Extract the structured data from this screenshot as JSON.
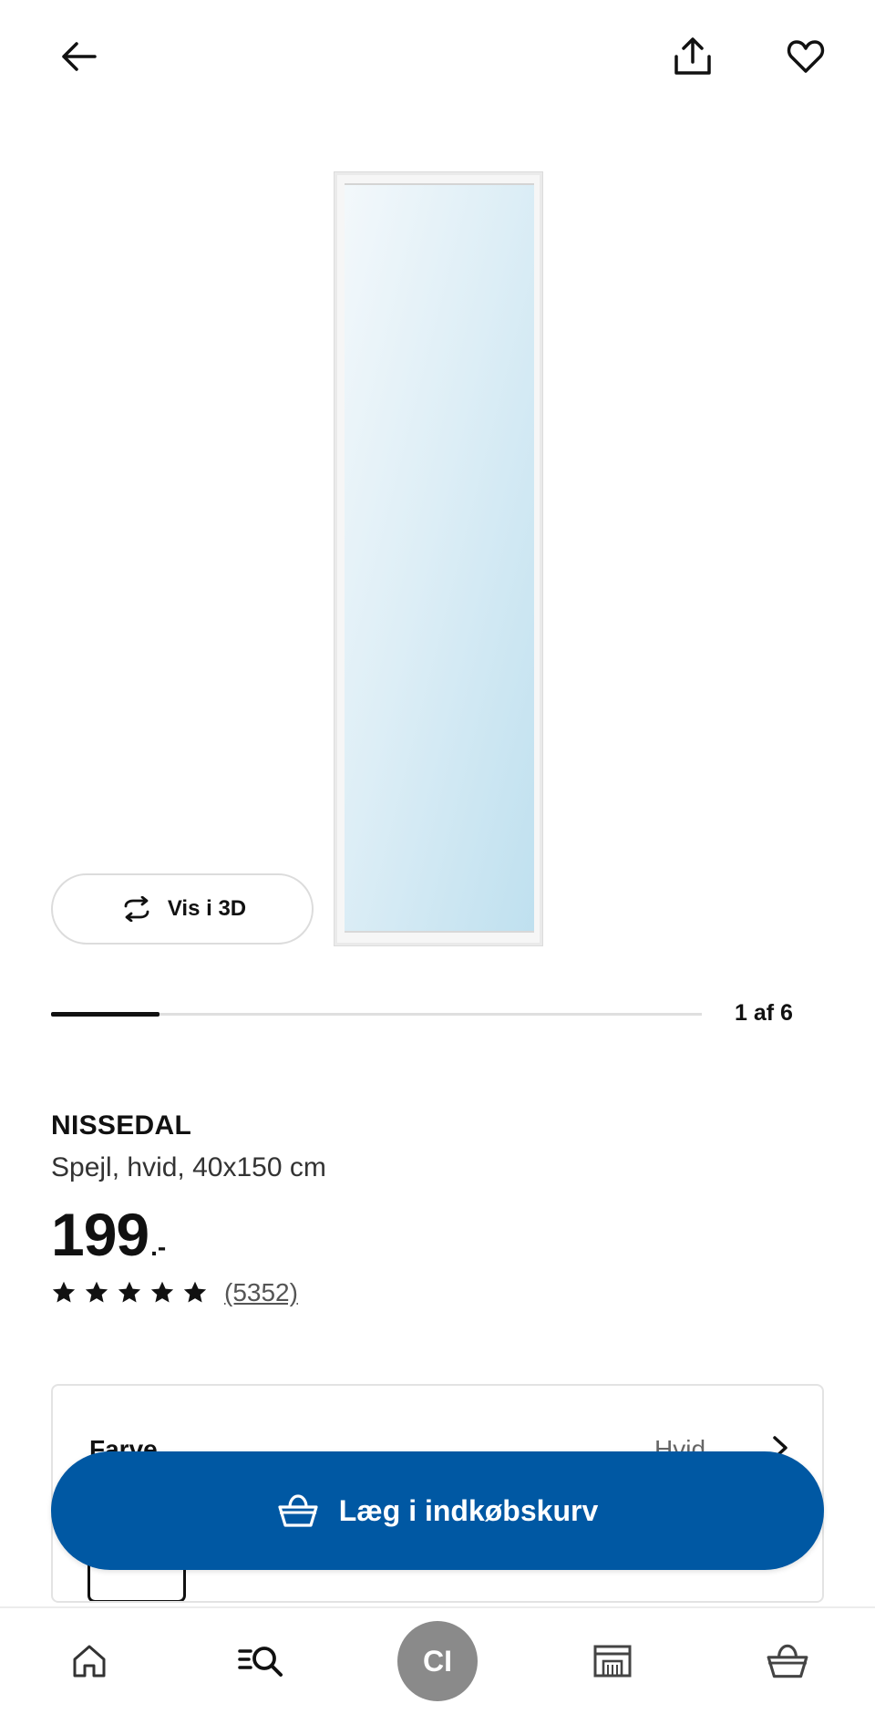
{
  "gallery": {
    "counter": "1 af 6",
    "current": 1,
    "total": 6,
    "view_3d_label": "Vis i 3D"
  },
  "product": {
    "name": "NISSEDAL",
    "description": "Spejl, hvid, 40x150 cm",
    "price_integer": "199",
    "price_suffix": ".-",
    "rating_stars": 5,
    "review_count": "(5352)"
  },
  "variant": {
    "label": "Farve",
    "value": "Hvid"
  },
  "cart_button": {
    "label": "Læg i indkøbskurv"
  },
  "bottom_nav": {
    "avatar_initials": "CI",
    "items": [
      "home-icon",
      "search-icon",
      "avatar",
      "store-icon",
      "basket-icon"
    ]
  },
  "colors": {
    "brand_blue": "#0058a3",
    "text": "#111111",
    "avatar_grey": "#8a8a8a"
  }
}
